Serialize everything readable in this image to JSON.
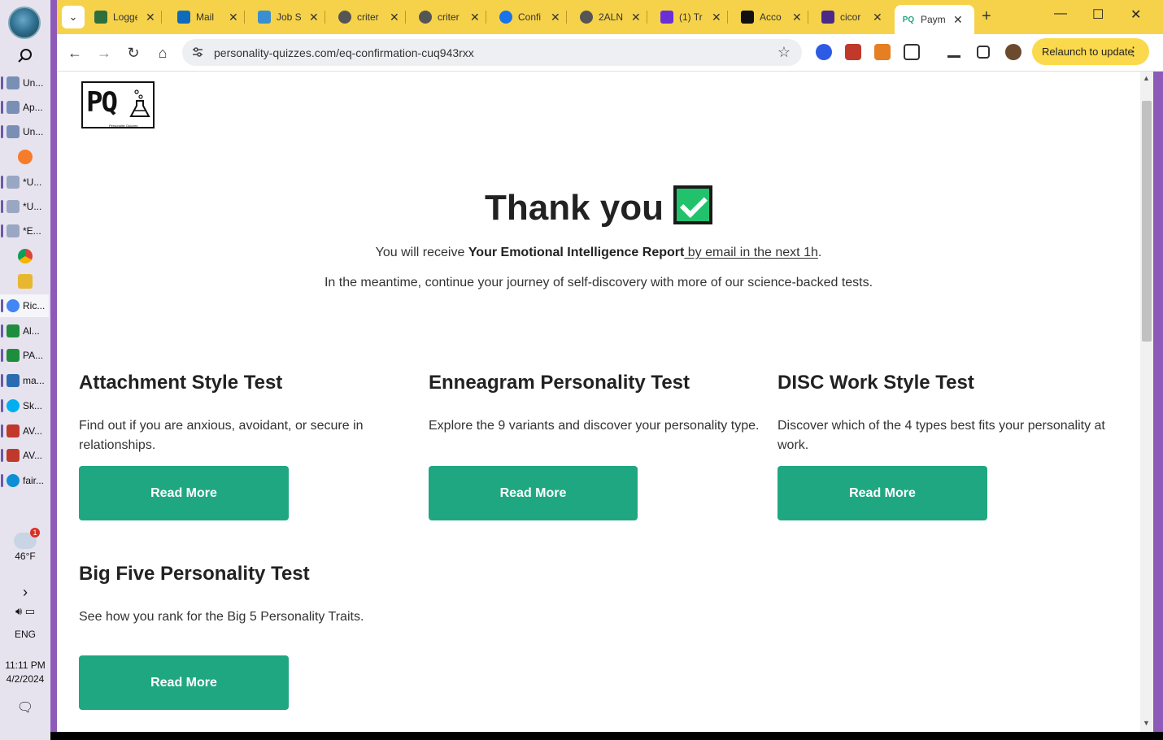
{
  "taskbar": {
    "items": [
      {
        "label": "Un...",
        "color": "#7a8fb5"
      },
      {
        "label": "Ap...",
        "color": "#7a8fb5"
      },
      {
        "label": "Un...",
        "color": "#7a8fb5"
      },
      {
        "label": "*U...",
        "color": "#9aa7c2"
      },
      {
        "label": "*U...",
        "color": "#9aa7c2"
      },
      {
        "label": "*E...",
        "color": "#9aa7c2"
      },
      {
        "label": "Ric...",
        "color": "#4285f4"
      },
      {
        "label": "Al...",
        "color": "#1e8e3e"
      },
      {
        "label": "PA...",
        "color": "#1e8e3e"
      },
      {
        "label": "ma...",
        "color": "#2b6cb0"
      },
      {
        "label": "Sk...",
        "color": "#00aff0"
      },
      {
        "label": "AV...",
        "color": "#c0392b"
      },
      {
        "label": "AV...",
        "color": "#c0392b"
      },
      {
        "label": "fair...",
        "color": "#0c8fd6"
      }
    ],
    "weather_temp": "46°F",
    "weather_badge": "1",
    "language": "ENG",
    "time": "11:11 PM",
    "date": "4/2/2024"
  },
  "tabs": [
    {
      "title": "Logge",
      "fav": "#2e6f3e"
    },
    {
      "title": "Mail",
      "fav": "#0f6cbd"
    },
    {
      "title": "Job S",
      "fav": "#3a8fd0"
    },
    {
      "title": "criter",
      "fav": "#555555"
    },
    {
      "title": "criter",
      "fav": "#555555"
    },
    {
      "title": "Confi",
      "fav": "#1a73e8"
    },
    {
      "title": "2ALN",
      "fav": "#555555"
    },
    {
      "title": "(1) Tr",
      "fav": "#6b2fd6"
    },
    {
      "title": "Acco",
      "fav": "#111111"
    },
    {
      "title": "cicor",
      "fav": "#4b2a8a"
    }
  ],
  "active_tab": {
    "title": "Paym",
    "fav_text": "PQ"
  },
  "toolbar": {
    "url": "personality-quizzes.com/eq-confirmation-cuq943rxx",
    "relaunch": "Relaunch to update"
  },
  "page": {
    "logo_text": "PQ",
    "logo_sub": "Personality Quizzes",
    "title": "Thank you",
    "receive_prefix": "You will receive ",
    "receive_bold": "Your Emotional Intelligence Report",
    "receive_link": " by email in the next 1h",
    "receive_suffix": ".",
    "meantime": "In the meantime, continue your journey of self-discovery with more of our science-backed tests.",
    "tests": [
      {
        "title": "Attachment Style Test",
        "desc": "Find out if you are anxious, avoidant, or secure in relationships.",
        "button": "Read More"
      },
      {
        "title": "Enneagram Personality Test",
        "desc": "Explore the 9 variants and discover your personality type.",
        "button": "Read More"
      },
      {
        "title": "DISC Work Style Test",
        "desc": "Discover which of the 4 types best fits your personality at work.",
        "button": "Read More"
      },
      {
        "title": "Big Five Personality Test",
        "desc": "See how you rank for the Big 5 Personality Traits.",
        "button": "Read More"
      }
    ]
  },
  "colors": {
    "tabstrip": "#f6d24a",
    "frame": "#8e5ab8",
    "button_green": "#1fa781",
    "check_green": "#21c26b"
  }
}
